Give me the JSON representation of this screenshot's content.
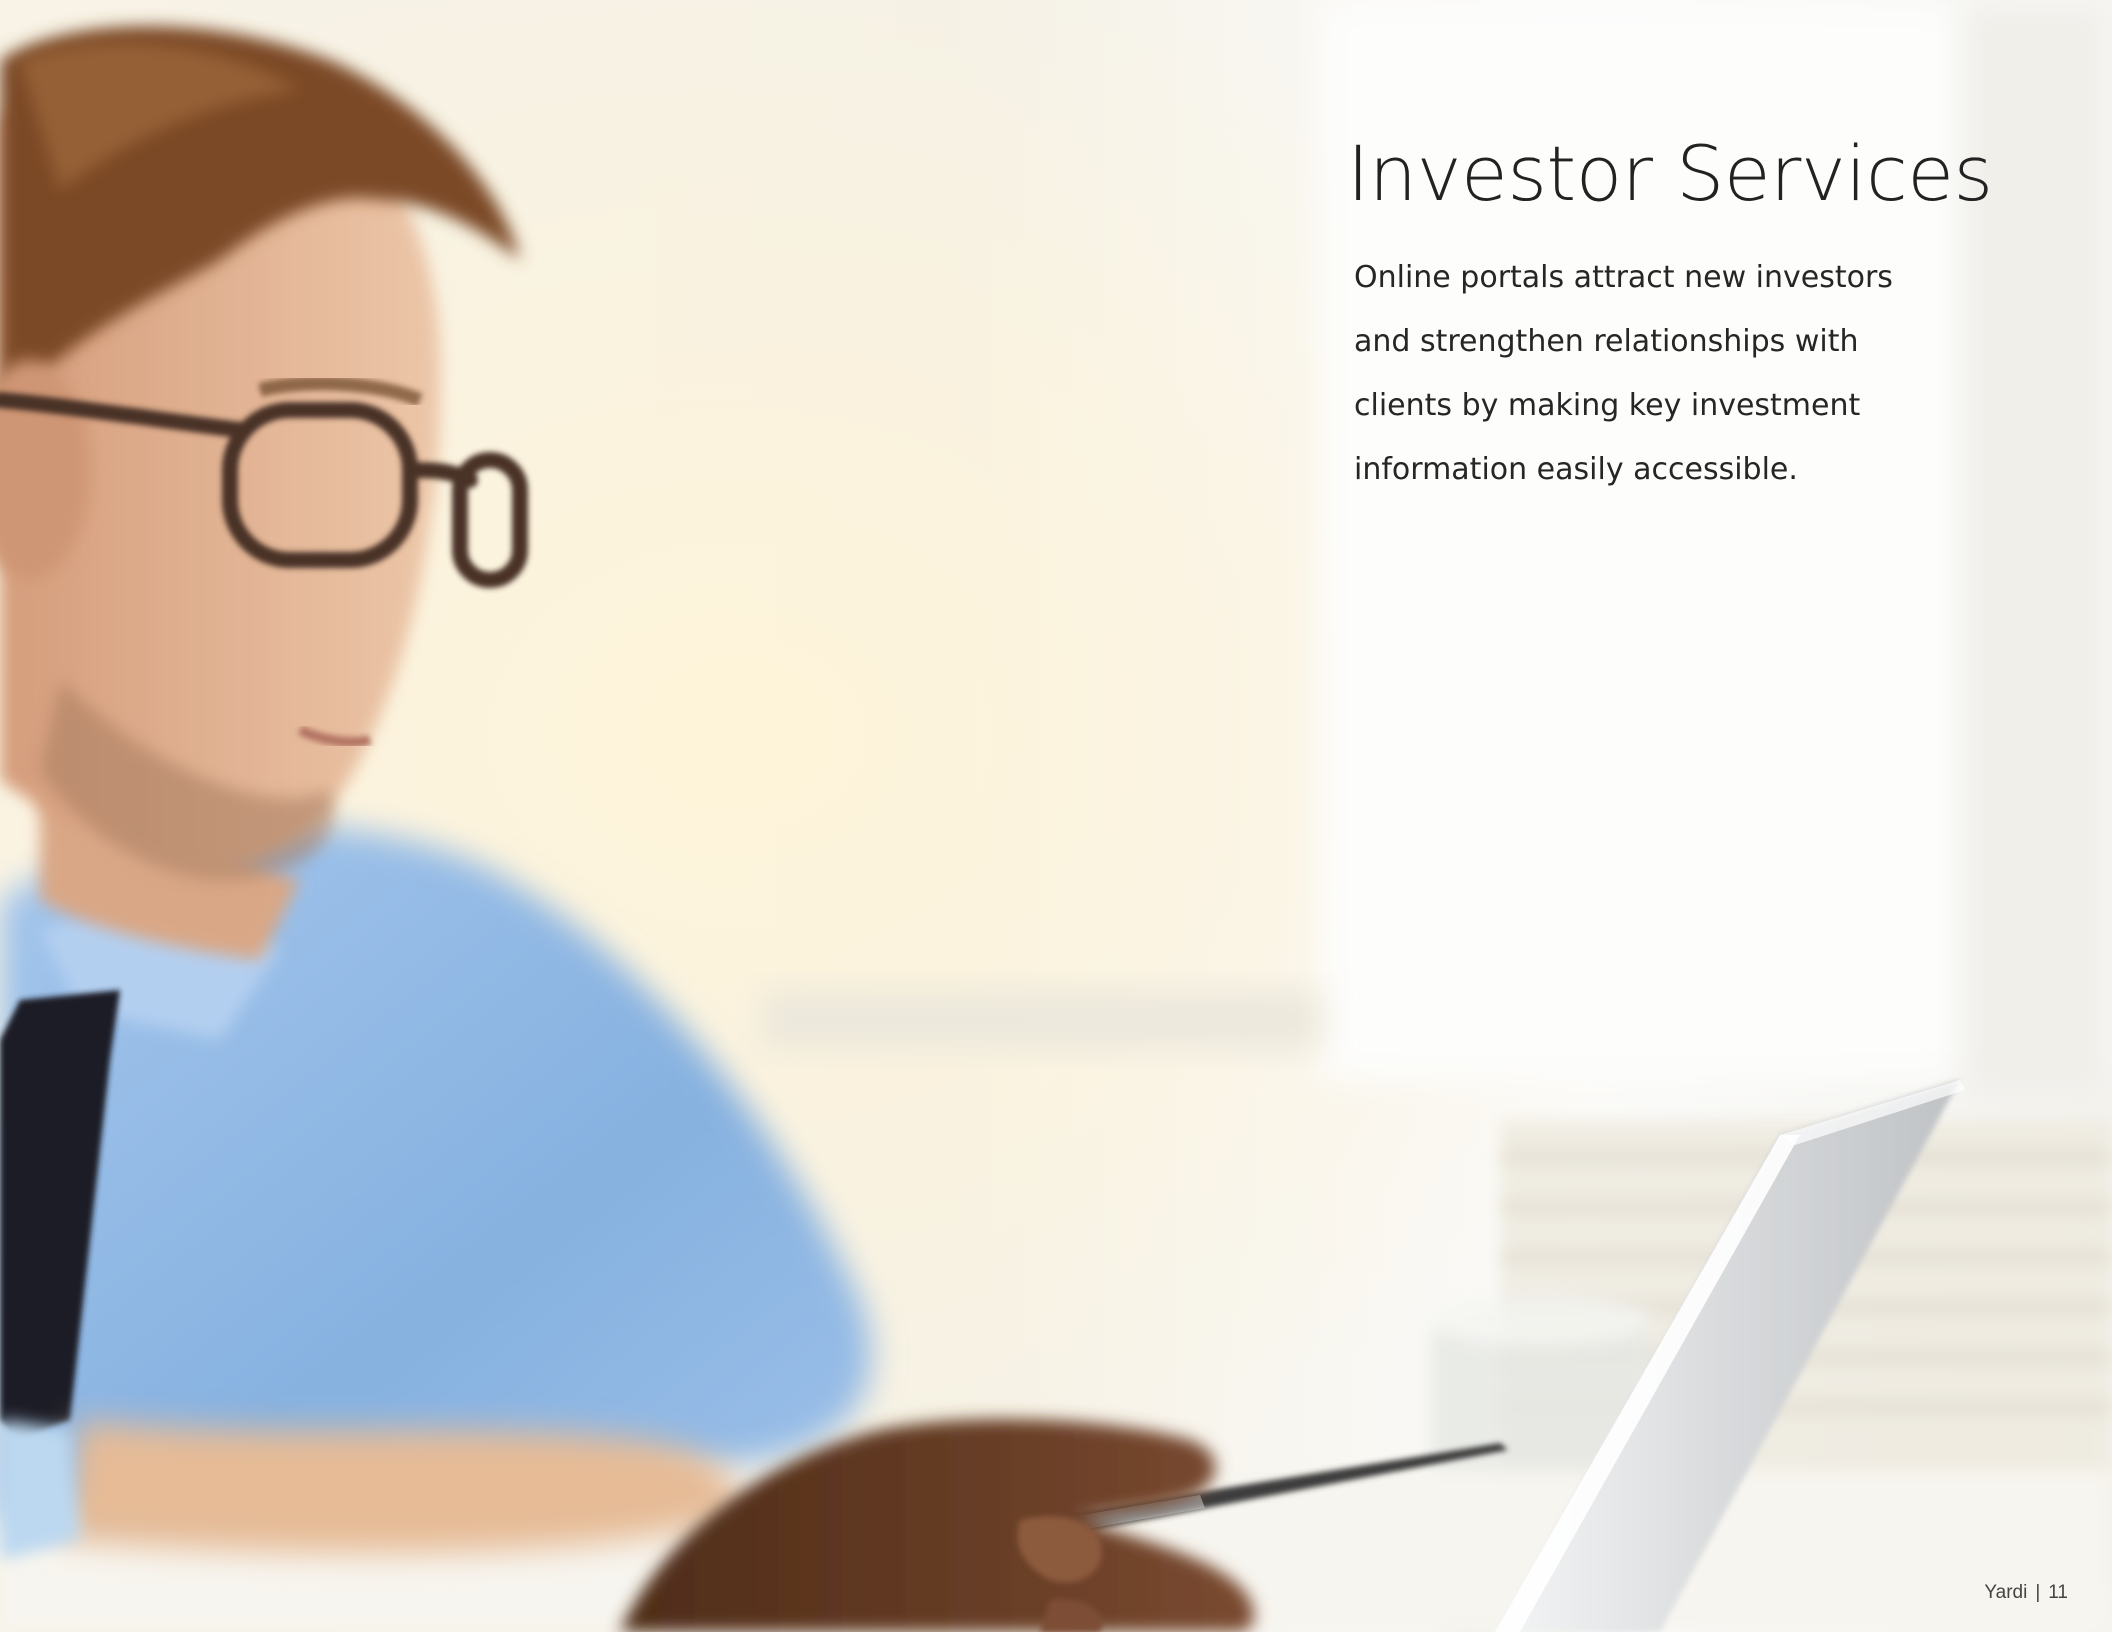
{
  "page": {
    "title": "Investor Services",
    "body_lines": [
      "Online portals attract new investors",
      "and strengthen relationships with",
      "clients by making key investment",
      "information easily accessible."
    ],
    "footer": {
      "brand": "Yardi",
      "separator": "|",
      "page_number": "11"
    }
  },
  "photo": {
    "description_icon": "business-photo",
    "colors": {
      "background": "#f6f3ea",
      "shirt": "#8fb8e4",
      "hair": "#7a4a26",
      "skin": "#e0b292",
      "hand": "#6a4028",
      "tie": "#1e1e26",
      "laptop": "#e4e6e8"
    }
  }
}
